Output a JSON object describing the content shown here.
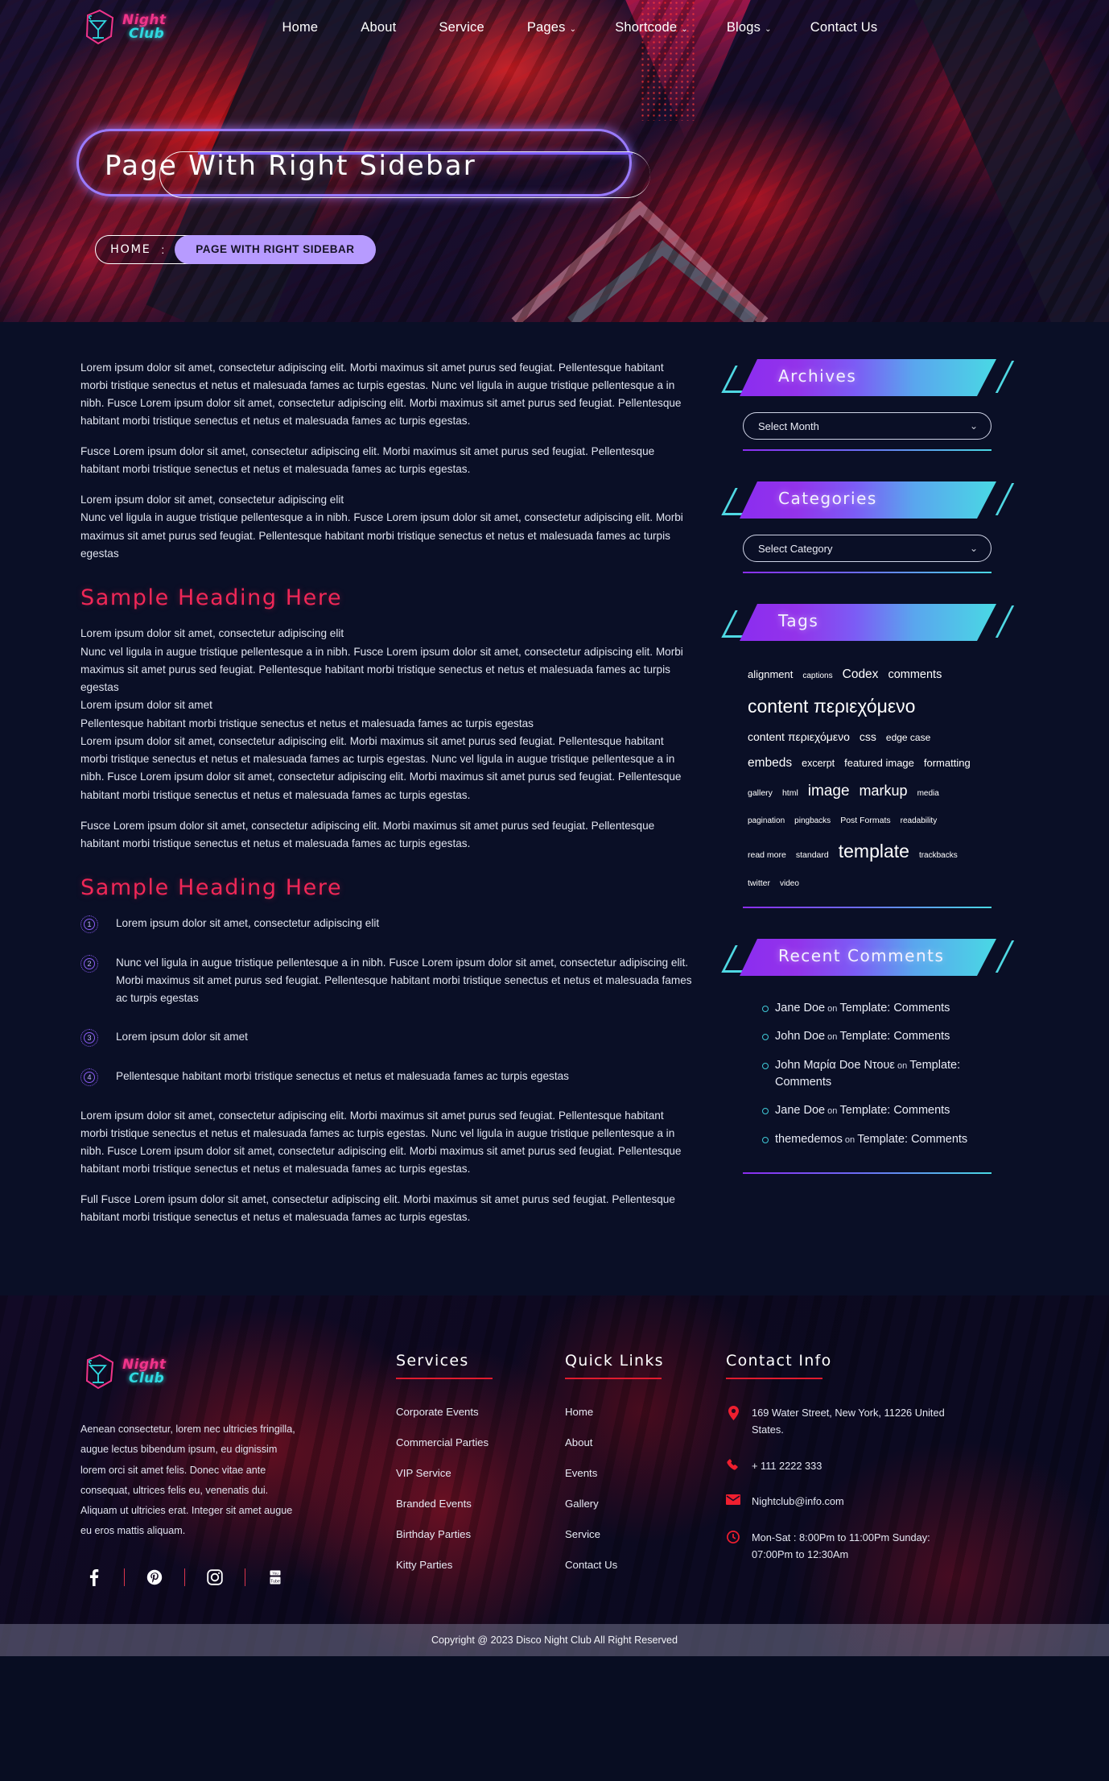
{
  "site": {
    "logo_night": "Night",
    "logo_club": "Club"
  },
  "nav": {
    "items": [
      {
        "label": "Home",
        "caret": ""
      },
      {
        "label": "About",
        "caret": ""
      },
      {
        "label": "Service",
        "caret": ""
      },
      {
        "label": "Pages",
        "caret": "⌄"
      },
      {
        "label": "Shortcode",
        "caret": "⌄"
      },
      {
        "label": "Blogs",
        "caret": "⌄"
      },
      {
        "label": "Contact Us",
        "caret": ""
      }
    ]
  },
  "hero": {
    "title": "Page With Right Sidebar",
    "breadcrumb_home": "HOME",
    "breadcrumb_sep": ":",
    "breadcrumb_current": "PAGE WITH RIGHT SIDEBAR"
  },
  "main": {
    "p1": "Lorem ipsum dolor sit amet, consectetur adipiscing elit. Morbi maximus sit amet purus sed feugiat. Pellentesque habitant morbi tristique senectus et netus et malesuada fames ac turpis egestas. Nunc vel ligula in augue tristique pellentesque a in nibh. Fusce Lorem ipsum dolor sit amet, consectetur adipiscing elit. Morbi maximus sit amet purus sed feugiat. Pellentesque habitant morbi tristique senectus et netus et malesuada fames ac turpis egestas.",
    "p2": "Fusce Lorem ipsum dolor sit amet, consectetur adipiscing elit. Morbi maximus sit amet purus sed feugiat. Pellentesque habitant morbi tristique senectus et netus et malesuada fames ac turpis egestas.",
    "b1_l1": "Lorem ipsum dolor sit amet, consectetur adipiscing elit",
    "b1_l2": "Nunc vel ligula in augue tristique pellentesque a in nibh. Fusce Lorem ipsum dolor sit amet, consectetur adipiscing elit. Morbi maximus sit amet purus sed feugiat. Pellentesque habitant morbi tristique senectus et netus et malesuada fames ac turpis egestas",
    "heading1": "Sample Heading Here",
    "b2_l1": "Lorem ipsum dolor sit amet, consectetur adipiscing elit",
    "b2_l2": "Nunc vel ligula in augue tristique pellentesque a in nibh. Fusce Lorem ipsum dolor sit amet, consectetur adipiscing elit. Morbi maximus sit amet purus sed feugiat. Pellentesque habitant morbi tristique senectus et netus et malesuada fames ac turpis egestas",
    "b2_l3": "Lorem ipsum dolor sit amet",
    "b2_l4": "Pellentesque habitant morbi tristique senectus et netus et malesuada fames ac turpis egestas",
    "b2_l5": "Lorem ipsum dolor sit amet, consectetur adipiscing elit. Morbi maximus sit amet purus sed feugiat. Pellentesque habitant morbi tristique senectus et netus et malesuada fames ac turpis egestas. Nunc vel ligula in augue tristique pellentesque a in nibh. Fusce Lorem ipsum dolor sit amet, consectetur adipiscing elit. Morbi maximus sit amet purus sed feugiat. Pellentesque habitant morbi tristique senectus et netus et malesuada fames ac turpis egestas.",
    "p3": "Fusce Lorem ipsum dolor sit amet, consectetur adipiscing elit. Morbi maximus sit amet purus sed feugiat. Pellentesque habitant morbi tristique senectus et netus et malesuada fames ac turpis egestas.",
    "heading2": "Sample Heading Here",
    "list": [
      {
        "num": "1",
        "text": "Lorem ipsum dolor sit amet, consectetur adipiscing elit"
      },
      {
        "num": "2",
        "text": "Nunc vel ligula in augue tristique pellentesque a in nibh. Fusce Lorem ipsum dolor sit amet, consectetur adipiscing elit. Morbi maximus sit amet purus sed feugiat. Pellentesque habitant morbi tristique senectus et netus et malesuada fames ac turpis egestas"
      },
      {
        "num": "3",
        "text": "Lorem ipsum dolor sit amet"
      },
      {
        "num": "4",
        "text": "Pellentesque habitant morbi tristique senectus et netus et malesuada fames ac turpis egestas"
      }
    ],
    "p4": "Lorem ipsum dolor sit amet, consectetur adipiscing elit. Morbi maximus sit amet purus sed feugiat. Pellentesque habitant morbi tristique senectus et netus et malesuada fames ac turpis egestas. Nunc vel ligula in augue tristique pellentesque a in nibh. Fusce Lorem ipsum dolor sit amet, consectetur adipiscing elit. Morbi maximus sit amet purus sed feugiat. Pellentesque habitant morbi tristique senectus et netus et malesuada fames ac turpis egestas.",
    "p5": "Full Fusce Lorem ipsum dolor sit amet, consectetur adipiscing elit. Morbi maximus sit amet purus sed feugiat. Pellentesque habitant morbi tristique senectus et netus et malesuada fames ac turpis egestas."
  },
  "sidebar": {
    "archives": {
      "title": "Archives",
      "select_value": "Select Month"
    },
    "categories": {
      "title": "Categories",
      "select_value": "Select Category"
    },
    "tags": {
      "title": "Tags",
      "items": [
        {
          "label": "alignment",
          "size": 13
        },
        {
          "label": "captions",
          "size": 10
        },
        {
          "label": "Codex",
          "size": 15.5
        },
        {
          "label": "comments",
          "size": 14.5
        },
        {
          "label": "content περιεχόμενο",
          "size": 23
        },
        {
          "label": "content περιεχόμενο",
          "size": 14
        },
        {
          "label": "css",
          "size": 14
        },
        {
          "label": "edge case",
          "size": 12
        },
        {
          "label": "embeds",
          "size": 15.5
        },
        {
          "label": "excerpt",
          "size": 12.5
        },
        {
          "label": "featured image",
          "size": 13
        },
        {
          "label": "formatting",
          "size": 13
        },
        {
          "label": "gallery",
          "size": 10.5
        },
        {
          "label": "html",
          "size": 10.5
        },
        {
          "label": "image",
          "size": 19
        },
        {
          "label": "markup",
          "size": 18
        },
        {
          "label": "media",
          "size": 10
        },
        {
          "label": "pagination",
          "size": 10
        },
        {
          "label": "pingbacks",
          "size": 10
        },
        {
          "label": "Post Formats",
          "size": 10.5
        },
        {
          "label": "readability",
          "size": 10
        },
        {
          "label": "read more",
          "size": 10.5
        },
        {
          "label": "standard",
          "size": 10.5
        },
        {
          "label": "template",
          "size": 23
        },
        {
          "label": "trackbacks",
          "size": 10
        },
        {
          "label": "twitter",
          "size": 10.5
        },
        {
          "label": "video",
          "size": 10
        }
      ]
    },
    "recent_comments": {
      "title": "Recent Comments",
      "items": [
        {
          "author": "Jane Doe",
          "on": "on",
          "post": "Template: Comments"
        },
        {
          "author": "John Doe",
          "on": "on",
          "post": "Template: Comments"
        },
        {
          "author": "John Μαρία Doe Ντουε",
          "on": "on",
          "post": "Template: Comments"
        },
        {
          "author": "Jane Doe",
          "on": "on",
          "post": "Template: Comments"
        },
        {
          "author": "themedemos",
          "on": "on",
          "post": "Template: Comments"
        }
      ]
    }
  },
  "footer": {
    "about": "Aenean consectetur, lorem nec ultricies fringilla, augue lectus bibendum ipsum, eu dignissim lorem orci sit amet felis. Donec vitae ante consequat, ultrices felis eu, venenatis dui. Aliquam ut ultricies erat. Integer sit amet augue eu eros mattis aliquam.",
    "socials": [
      {
        "name": "facebook-icon",
        "glyph": "f"
      },
      {
        "name": "pinterest-icon",
        "glyph": "P"
      },
      {
        "name": "instagram-icon",
        "glyph": "▢"
      },
      {
        "name": "youtube-icon",
        "glyph": "▶"
      }
    ],
    "services": {
      "title": "Services",
      "items": [
        "Corporate Events",
        "Commercial Parties",
        "VIP Service",
        "Branded Events",
        "Birthday Parties",
        "Kitty Parties"
      ]
    },
    "quick_links": {
      "title": "Quick Links",
      "items": [
        "Home",
        "About",
        "Events",
        "Gallery",
        "Service",
        "Contact Us"
      ]
    },
    "contact": {
      "title": "Contact Info",
      "address": "169 Water Street, New York, 11226 United States.",
      "phone": "+ 111 2222 333",
      "email": "Nightclub@info.com",
      "hours_1": "Mon-Sat : 8:00Pm to 11:00Pm",
      "hours_2": "Sunday: 07:00Pm to 12:30Am"
    },
    "copyright": "Copyright @ 2023 Disco Night Club All Right Reserved"
  }
}
